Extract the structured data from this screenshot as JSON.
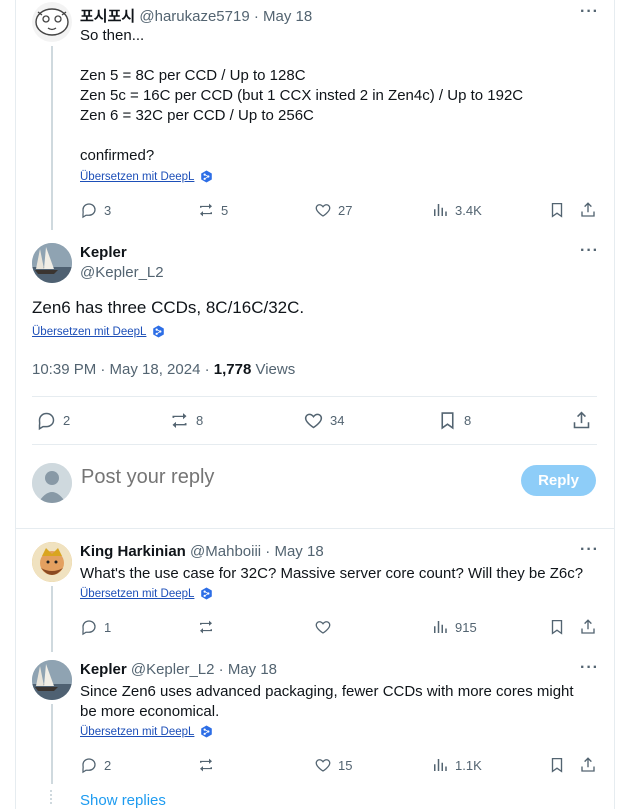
{
  "tweet1": {
    "display_name": "포시포시",
    "handle": "@harukaze5719",
    "sep": "·",
    "date": "May 18",
    "lines": [
      "So then...",
      "",
      "Zen 5 = 8C per CCD / Up to 128C",
      "Zen 5c = 16C per CCD (but 1 CCX insted 2 in Zen4c) / Up to 192C",
      "Zen 6 = 32C per CCD / Up to 256C",
      "",
      "confirmed?"
    ],
    "translate": "Übersetzen mit DeepL",
    "replies": "3",
    "reposts": "5",
    "likes": "27",
    "views": "3.4K"
  },
  "main": {
    "display_name": "Kepler",
    "handle": "@Kepler_L2",
    "text": "Zen6 has three CCDs, 8C/16C/32C.",
    "translate": "Übersetzen mit DeepL",
    "time": "10:39 PM · May 18, 2024 ·",
    "views_count": "1,778",
    "views_label": "Views",
    "replies": "2",
    "reposts": "8",
    "likes": "34",
    "bookmarks": "8"
  },
  "composer": {
    "placeholder": "Post your reply",
    "button": "Reply"
  },
  "reply1": {
    "display_name": "King Harkinian",
    "handle": "@Mahboiii",
    "sep": "·",
    "date": "May 18",
    "text": "What's the use case for 32C? Massive server core count? Will they be Z6c?",
    "translate": "Übersetzen mit DeepL",
    "replies": "1",
    "views": "915"
  },
  "reply2": {
    "display_name": "Kepler",
    "handle": "@Kepler_L2",
    "sep": "·",
    "date": "May 18",
    "line1": "Since Zen6 uses advanced packaging, fewer CCDs with more cores might",
    "line2": "be more economical.",
    "translate": "Übersetzen mit DeepL",
    "replies": "2",
    "likes": "15",
    "views": "1.1K"
  },
  "show_replies": "Show replies",
  "colors": {
    "accent": "#1d9bf0",
    "reply_button": "#8ecdf8",
    "muted": "#536471",
    "deepl": "#1d4fb8"
  }
}
